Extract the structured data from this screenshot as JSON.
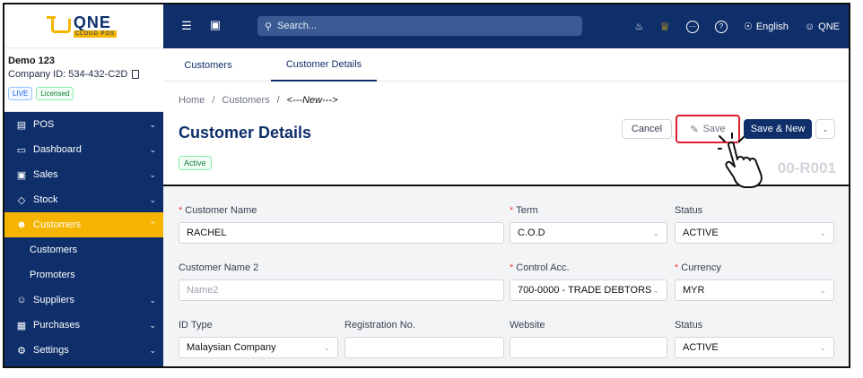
{
  "brand": {
    "name": "QNE",
    "sub": "CLOUD POS"
  },
  "company": {
    "name": "Demo 123",
    "id_label": "Company ID: 534-432-C2D",
    "badges": [
      "LIVE",
      "Licensed"
    ]
  },
  "sidebar": {
    "items": [
      {
        "label": "POS",
        "icon": "receipt-icon"
      },
      {
        "label": "Dashboard",
        "icon": "monitor-icon"
      },
      {
        "label": "Sales",
        "icon": "cart-icon"
      },
      {
        "label": "Stock",
        "icon": "box-icon"
      },
      {
        "label": "Customers",
        "icon": "customers-icon",
        "active": true
      },
      {
        "label": "Suppliers",
        "icon": "supplier-icon"
      },
      {
        "label": "Purchases",
        "icon": "purchase-icon"
      },
      {
        "label": "Settings",
        "icon": "gear-icon"
      }
    ],
    "sub_items": [
      "Customers",
      "Promoters"
    ]
  },
  "topbar": {
    "search_placeholder": "Search...",
    "language": "English",
    "user": "QNE"
  },
  "tabs": [
    "Customers",
    "Customer Details"
  ],
  "breadcrumb": [
    "Home",
    "Customers",
    "<---New--->"
  ],
  "page": {
    "title": "Customer Details",
    "status": "Active",
    "doc_no": "00-R001",
    "buttons": {
      "cancel": "Cancel",
      "save": "Save",
      "save_new": "Save & New"
    }
  },
  "form": {
    "customer_name": {
      "label": "Customer Name",
      "value": "RACHEL"
    },
    "term": {
      "label": "Term",
      "value": "C.O.D"
    },
    "status1": {
      "label": "Status",
      "value": "ACTIVE"
    },
    "customer_name2": {
      "label": "Customer Name 2",
      "placeholder": "Name2"
    },
    "control_acc": {
      "label": "Control Acc.",
      "value": "700-0000 - TRADE DEBTORS"
    },
    "currency": {
      "label": "Currency",
      "value": "MYR"
    },
    "id_type": {
      "label": "ID Type",
      "value": "Malaysian Company"
    },
    "registration": {
      "label": "Registration No.",
      "value": ""
    },
    "website": {
      "label": "Website",
      "value": ""
    },
    "status2": {
      "label": "Status",
      "value": "ACTIVE"
    }
  },
  "colors": {
    "navy": "#0f2f6b",
    "accent": "#f5b400",
    "highlight": "#e11d2e"
  }
}
